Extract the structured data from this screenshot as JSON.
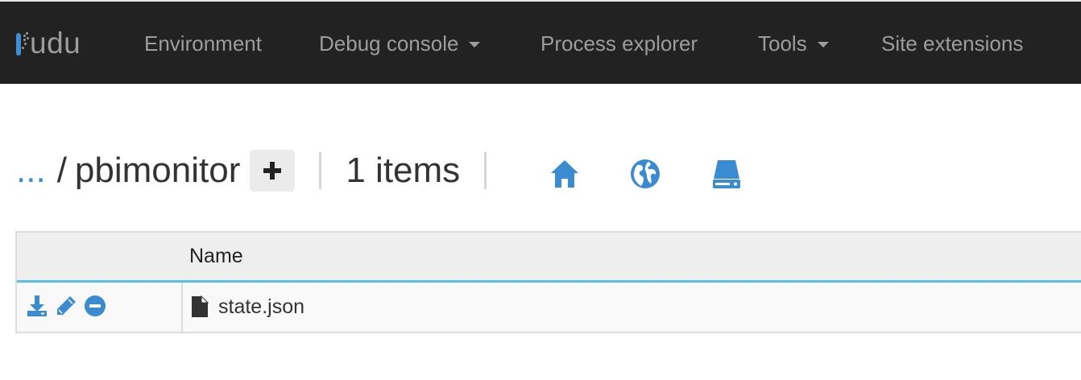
{
  "navbar": {
    "brand": "kudu",
    "brand_text": "udu",
    "items": [
      {
        "label": "Environment",
        "dropdown": false
      },
      {
        "label": "Debug console",
        "dropdown": true
      },
      {
        "label": "Process explorer",
        "dropdown": false
      },
      {
        "label": "Tools",
        "dropdown": true
      },
      {
        "label": "Site extensions",
        "dropdown": false
      }
    ]
  },
  "breadcrumb": {
    "ellipsis": "...",
    "separator": "/",
    "current": "pbimonitor",
    "add_button_icon": "plus-icon",
    "items_count": "1 items"
  },
  "location_icons": [
    "home-icon",
    "globe-icon",
    "drive-icon"
  ],
  "table": {
    "columns": [
      "",
      "Name"
    ],
    "rows": [
      {
        "actions": [
          "download-icon",
          "edit-icon",
          "delete-icon"
        ],
        "file_icon": "file-icon",
        "name": "state.json"
      }
    ]
  },
  "colors": {
    "navbar_bg": "#222222",
    "nav_text": "#9d9d9d",
    "accent": "#3a8bd0",
    "header_border": "#5bc0de"
  }
}
